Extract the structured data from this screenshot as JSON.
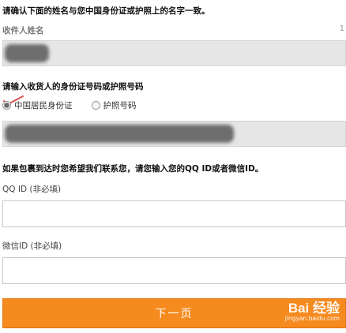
{
  "notes": {
    "top": "请确认下面的姓名与您中国身份证或护照上的名字一致。",
    "id": "请输入收货人的身份证号码或护照号码",
    "contact": "如果包裹到达时您希望我们联系您，请您输入您的QQ ID或者微信ID。"
  },
  "name_field": {
    "label": "收件人姓名",
    "marker": "1"
  },
  "id_type": {
    "options": [
      "中国居民身份证",
      "护照号码"
    ],
    "selected": "中国居民身份证"
  },
  "qq_field": {
    "label": "QQ ID (非必填)",
    "value": ""
  },
  "wechat_field": {
    "label": "微信ID (非必填)",
    "value": ""
  },
  "next_button": {
    "label": "下一页"
  },
  "watermark": {
    "logo": "Bai 经验",
    "url": "jingyan.baidu.com"
  },
  "colors": {
    "button": "#f58a1f",
    "bar": "#e6e6e6",
    "check": "#d9534f"
  }
}
